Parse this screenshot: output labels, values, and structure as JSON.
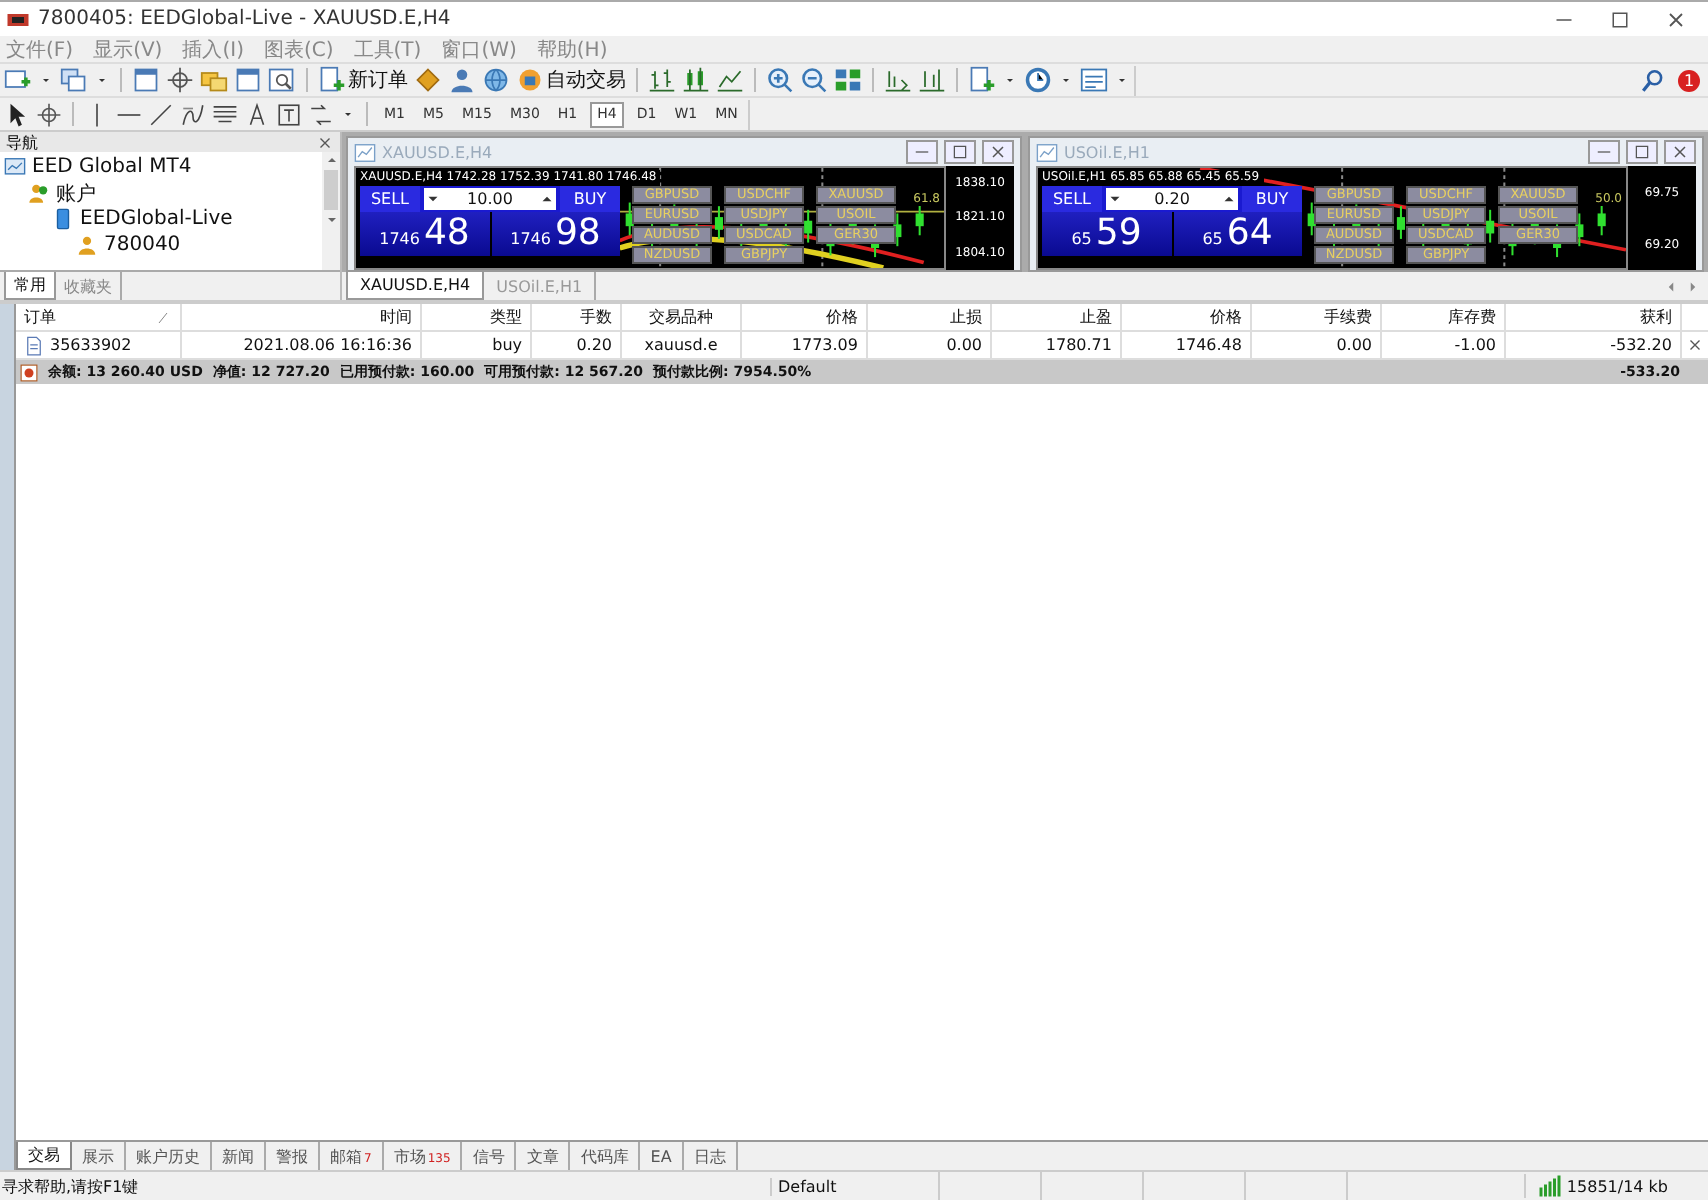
{
  "window": {
    "title": "7800405: EEDGlobal-Live - XAUUSD.E,H4"
  },
  "menu": [
    "文件(F)",
    "显示(V)",
    "插入(I)",
    "图表(C)",
    "工具(T)",
    "窗口(W)",
    "帮助(H)"
  ],
  "toolbar": {
    "new_order": "新订单",
    "auto_trading": "自动交易",
    "notification_badge": "1"
  },
  "timeframes": [
    {
      "label": "M1",
      "selected": false
    },
    {
      "label": "M5",
      "selected": false
    },
    {
      "label": "M15",
      "selected": false
    },
    {
      "label": "M30",
      "selected": false
    },
    {
      "label": "H1",
      "selected": false
    },
    {
      "label": "H4",
      "selected": true
    },
    {
      "label": "D1",
      "selected": false
    },
    {
      "label": "W1",
      "selected": false
    },
    {
      "label": "MN",
      "selected": false
    }
  ],
  "navigator": {
    "title": "导航",
    "tree": [
      {
        "label": "EED Global MT4",
        "kind": "root",
        "children": [
          {
            "label": "账户",
            "kind": "folder",
            "children": [
              {
                "label": "EEDGlobal-Live",
                "kind": "server",
                "children": [
                  {
                    "label": "780040",
                    "kind": "account"
                  }
                ]
              }
            ]
          }
        ]
      }
    ],
    "tabs": [
      {
        "label": "常用",
        "selected": true
      },
      {
        "label": "收藏夹",
        "selected": false
      }
    ]
  },
  "charts": [
    {
      "title": "XAUUSD.E,H4",
      "info": "XAUUSD.E,H4  1742.28 1752.39 1741.80 1746.48",
      "sell_label": "SELL",
      "buy_label": "BUY",
      "volume": "10.00",
      "sell_price": {
        "base": "1746",
        "big": "48"
      },
      "buy_price": {
        "base": "1746",
        "big": "98"
      },
      "symbols": [
        "GBPUSD",
        "USDCHF",
        "XAUUSD",
        "EURUSD",
        "USDJPY",
        "USOIL",
        "AUDUSD",
        "USDCAD",
        "GER30",
        "NZDUSD",
        "GBPJPY"
      ],
      "price_labels": [
        "1838.10",
        "1821.10",
        "1804.10"
      ],
      "level_label": "61.8"
    },
    {
      "title": "USOil.E,H1",
      "info": "USOil.E,H1  65.85 65.88 65.45 65.59",
      "sell_label": "SELL",
      "buy_label": "BUY",
      "volume": "0.20",
      "sell_price": {
        "base": "65",
        "big": "59"
      },
      "buy_price": {
        "base": "65",
        "big": "64"
      },
      "symbols": [
        "GBPUSD",
        "USDCHF",
        "XAUUSD",
        "EURUSD",
        "USDJPY",
        "USOIL",
        "AUDUSD",
        "USDCAD",
        "GER30",
        "NZDUSD",
        "GBPJPY"
      ],
      "price_labels": [
        "69.75",
        "69.20"
      ],
      "level_label": "50.0"
    }
  ],
  "chart_tabs": [
    {
      "label": "XAUUSD.E,H4",
      "selected": true
    },
    {
      "label": "USOil.E,H1",
      "selected": false
    }
  ],
  "table": {
    "columns": [
      "订单",
      "时间",
      "类型",
      "手数",
      "交易品种",
      "价格",
      "止损",
      "止盈",
      "价格",
      "手续费",
      "库存费",
      "获利"
    ],
    "rows": [
      [
        "35633902",
        "2021.08.06 16:16:36",
        "buy",
        "0.20",
        "xauusd.e",
        "1773.09",
        "0.00",
        "1780.71",
        "1746.48",
        "0.00",
        "-1.00",
        "-532.20"
      ]
    ],
    "summary": {
      "items": [
        "余额: 13 260.40 USD",
        "净值: 12 727.20",
        "已用预付款: 160.00",
        "可用预付款: 12 567.20",
        "预付款比例: 7954.50%"
      ],
      "total": "-533.20"
    }
  },
  "terminal_tabs": [
    {
      "label": "交易",
      "selected": true
    },
    {
      "label": "展示",
      "selected": false
    },
    {
      "label": "账户历史",
      "selected": false
    },
    {
      "label": "新闻",
      "selected": false
    },
    {
      "label": "警报",
      "selected": false
    },
    {
      "label": "邮箱",
      "selected": false,
      "badge": "7"
    },
    {
      "label": "市场",
      "selected": false,
      "badge": "135"
    },
    {
      "label": "信号",
      "selected": false
    },
    {
      "label": "文章",
      "selected": false
    },
    {
      "label": "代码库",
      "selected": false
    },
    {
      "label": "EA",
      "selected": false
    },
    {
      "label": "日志",
      "selected": false
    }
  ],
  "status_bar": {
    "help": "寻求帮助,请按F1键",
    "profile": "Default",
    "connection": "15851/14 kb"
  }
}
